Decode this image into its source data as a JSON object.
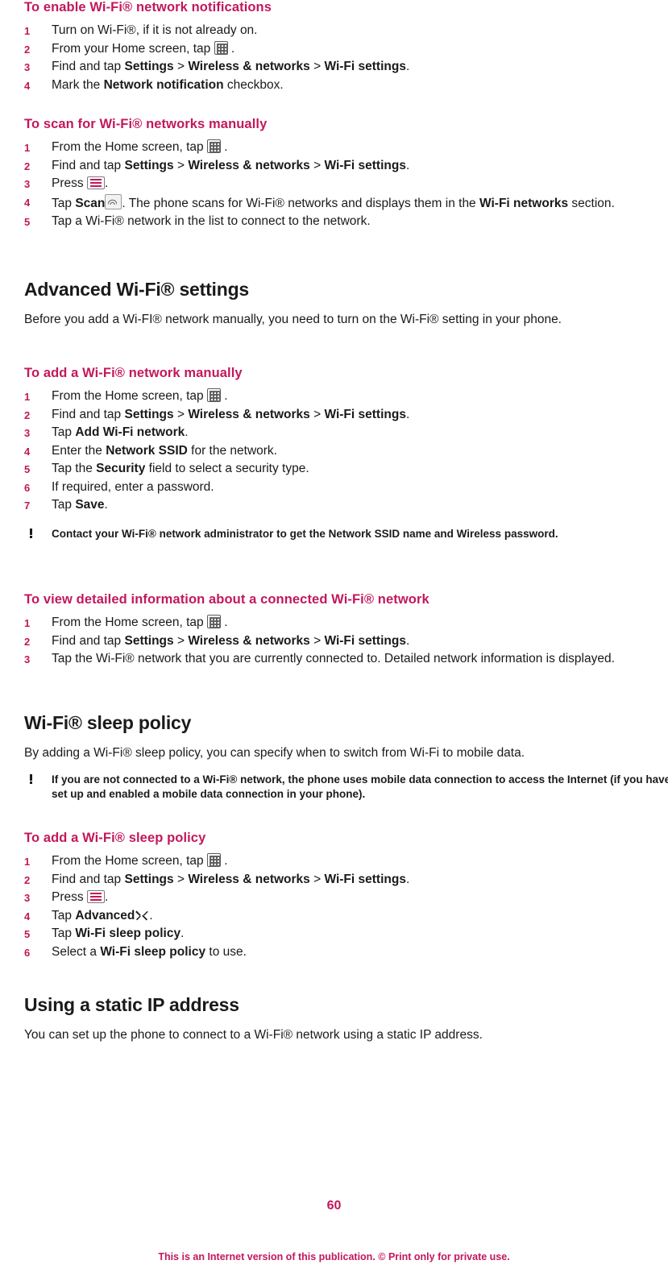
{
  "page": {
    "number": "60",
    "footer_bold": "This is an Internet version of this publication. ",
    "footer_rest": "© Print only for private use."
  },
  "blocks": {
    "proc_notifications": {
      "title": "To enable Wi-Fi® network notifications",
      "steps": [
        {
          "num": "1",
          "pre": "Turn on Wi-Fi®, if it is not already on."
        },
        {
          "num": "2",
          "pre": "From your Home screen, tap ",
          "icon": "apps-grid-icon",
          "post": " ."
        },
        {
          "num": "3",
          "pre": "Find and tap ",
          "b1": "Settings",
          "mid1": " > ",
          "b2": "Wireless & networks",
          "mid2": " > ",
          "b3": "Wi-Fi settings",
          "post": "."
        },
        {
          "num": "4",
          "pre": "Mark the ",
          "b1": "Network notification",
          "post": " checkbox."
        }
      ]
    },
    "proc_scan": {
      "title": "To scan for Wi-Fi® networks manually",
      "steps": [
        {
          "num": "1",
          "pre": "From the Home screen, tap ",
          "icon": "apps-grid-icon",
          "post": " ."
        },
        {
          "num": "2",
          "pre": "Find and tap ",
          "b1": "Settings",
          "mid1": " > ",
          "b2": "Wireless & networks",
          "mid2": " > ",
          "b3": "Wi-Fi settings",
          "post": "."
        },
        {
          "num": "3",
          "pre": "Press ",
          "icon": "menu-key-icon",
          "post": "."
        },
        {
          "num": "4",
          "pre": "Tap ",
          "b1": "Scan",
          "icon": "scan-icon",
          "mid1": ". The phone scans for Wi-Fi® networks and displays them in the ",
          "b2": "Wi-Fi networks",
          "post": " section."
        },
        {
          "num": "5",
          "pre": "Tap a Wi-Fi® network in the list to connect to the network."
        }
      ]
    },
    "advanced": {
      "title": "Advanced Wi-Fi® settings",
      "body": "Before you add a Wi-FI® network manually, you need to turn on the Wi-Fi® setting in your phone."
    },
    "proc_add": {
      "title": "To add a Wi-Fi® network manually",
      "steps": [
        {
          "num": "1",
          "pre": "From the Home screen, tap ",
          "icon": "apps-grid-icon",
          "post": " ."
        },
        {
          "num": "2",
          "pre": "Find and tap ",
          "b1": "Settings",
          "mid1": " > ",
          "b2": "Wireless & networks",
          "mid2": " > ",
          "b3": "Wi-Fi settings",
          "post": "."
        },
        {
          "num": "3",
          "pre": "Tap ",
          "b1": "Add Wi-Fi network",
          "post": "."
        },
        {
          "num": "4",
          "pre": "Enter the ",
          "b1": "Network SSID",
          "post": " for the network."
        },
        {
          "num": "5",
          "pre": "Tap the ",
          "b1": "Security",
          "post": " field to select a security type."
        },
        {
          "num": "6",
          "pre": "If required, enter a password."
        },
        {
          "num": "7",
          "pre": "Tap ",
          "b1": "Save",
          "post": "."
        }
      ]
    },
    "note_ssid": {
      "pre": "Contact your Wi-Fi® network administrator to get the ",
      "b1": "Network SSID",
      "mid": " name and ",
      "b2": "Wireless password",
      "post": "."
    },
    "proc_view": {
      "title": "To view detailed information about a connected Wi-Fi® network",
      "steps": [
        {
          "num": "1",
          "pre": "From the Home screen, tap ",
          "icon": "apps-grid-icon",
          "post": " ."
        },
        {
          "num": "2",
          "pre": "Find and tap ",
          "b1": "Settings",
          "mid1": " > ",
          "b2": "Wireless & networks",
          "mid2": " > ",
          "b3": "Wi-Fi settings",
          "post": "."
        },
        {
          "num": "3",
          "pre": "Tap the Wi-Fi® network that you are currently connected to. Detailed network information is displayed."
        }
      ]
    },
    "sleep": {
      "title": "Wi-Fi® sleep policy",
      "body": "By adding a Wi-Fi® sleep policy, you can specify when to switch from Wi-Fi to mobile data."
    },
    "note_sleep": {
      "text": "If you are not connected to a Wi-Fi® network, the phone uses mobile data connection to access the Internet (if you have set up and enabled a mobile data connection in your phone)."
    },
    "proc_sleep": {
      "title": "To add a Wi-Fi® sleep policy",
      "steps": [
        {
          "num": "1",
          "pre": "From the Home screen, tap ",
          "icon": "apps-grid-icon",
          "post": " ."
        },
        {
          "num": "2",
          "pre": "Find and tap ",
          "b1": "Settings",
          "mid1": " > ",
          "b2": "Wireless & networks",
          "mid2": " > ",
          "b3": "Wi-Fi settings",
          "post": "."
        },
        {
          "num": "3",
          "pre": "Press ",
          "icon": "menu-key-icon",
          "post": "."
        },
        {
          "num": "4",
          "pre": "Tap ",
          "b1": "Advanced",
          "icon": "wrench-icon",
          "post": "."
        },
        {
          "num": "5",
          "pre": "Tap ",
          "b1": "Wi-Fi sleep policy",
          "post": "."
        },
        {
          "num": "6",
          "pre": "Select a ",
          "b1": "Wi-Fi sleep policy",
          "post": " to use."
        }
      ]
    },
    "static_ip": {
      "title": "Using a static IP address",
      "body": "You can set up the phone to connect to a Wi-Fi® network using a static IP address."
    }
  }
}
